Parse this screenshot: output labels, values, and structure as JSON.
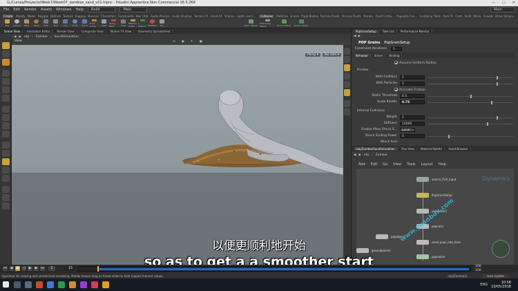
{
  "window": {
    "title": "G:/Cursos/Proyecto/Week7/Week07_zombies_sand_v01.hipnc - Houdini Apprentice Non-Commercial 16.5.268",
    "controls": [
      "—",
      "▢",
      "✕"
    ]
  },
  "menubar": {
    "items": [
      "File",
      "Edit",
      "Render",
      "Assets",
      "Windows",
      "Help"
    ],
    "build_label": "Build",
    "main_label": "Main",
    "desktop_label": "Main"
  },
  "shelf_tabs": [
    "Create",
    "Modify",
    "Model",
    "Polygon",
    "Deform",
    "Texture",
    "Rigging",
    "Muscles",
    "Characters",
    "Constraints",
    "Hair Utils",
    "Guide Process",
    "Guide Brushes",
    "Terrain FX",
    "Cloud FX",
    "Volume",
    "Lights and C...",
    "Collisions",
    "Particles",
    "Grains",
    "Rigid Bodies",
    "Particle Fluids",
    "Viscous Fluids",
    "Oceans",
    "Fluid Contai...",
    "Populate Con...",
    "Container Tools",
    "Pyro FX",
    "Cloth",
    "Solid",
    "Wires",
    "Crowds",
    "Drive Simula..."
  ],
  "shelf_tools": [
    "Box",
    "Sphere",
    "Tube",
    "Torus",
    "Grid",
    "Null",
    "Line",
    "Circle",
    "Curve",
    "Draw Curve",
    "Path",
    "Spray Paint",
    "Font",
    "Platonic Solids",
    "L-System",
    "Metaball",
    "File"
  ],
  "shelf_tools_right": [
    "Static Object",
    "Deforming Object",
    "Ground Plane",
    "Terrain Object"
  ],
  "pane_tabs": [
    "Scene View",
    "Animation Editor",
    "Render View",
    "Composite View",
    "Motion FX View",
    "Geometry Spreadsheet"
  ],
  "path": {
    "root": "obj",
    "node": "Zombie",
    "sub": "SandSimulation"
  },
  "view_label": "View",
  "viewport": {
    "persp": "Persp ▾",
    "camera": "No cam ▾"
  },
  "subtitles": {
    "chinese": "以便更顺利地开始",
    "english": "so as to get a a smoother start"
  },
  "params": {
    "tabs": [
      "PopGrainSetup",
      "Take List",
      "Performance Monitor"
    ],
    "node_type": "POP Grains",
    "node_name": "PopGrainSetup",
    "constraint_iterations_label": "Constraint Iterations",
    "constraint_iterations_value": "5",
    "sub_tabs": [
      "Behavior",
      "Solver",
      "Binding"
    ],
    "assume_uniform_radius": "Assume Uniform Radius",
    "friction_section": "Friction",
    "with_colliders_label": "With Colliders",
    "with_colliders_value": "1",
    "with_particles_label": "With Particles",
    "with_particles_value": "1",
    "accurate_friction": "Accurate Friction",
    "static_threshold_label": "Static Threshold",
    "static_threshold_value": "0.5",
    "scale_kinetic_label": "Scale Kinetic",
    "scale_kinetic_value": "0.75",
    "internal_collisions": "Internal Collisions",
    "weight_label": "Weight",
    "weight_value": "1",
    "stiffness_label": "Stiffness",
    "stiffness_value": "10000",
    "enable_mass_label": "Enable Mass Shock S...",
    "enable_mass_value": "Local",
    "shock_scaling_label": "Shock Scaling Power",
    "shock_scaling_value": "1",
    "shock_axis_label": "Shock Axis"
  },
  "network": {
    "tabs": [
      "/obj/Zombie/SandSimulation",
      "Tree View",
      "Material Palette",
      "Asset Browser"
    ],
    "path_root": "obj",
    "path_node": "Zombie",
    "menu": [
      "Add",
      "Edit",
      "Go",
      "View",
      "Tools",
      "Layout",
      "Help"
    ],
    "dynamics_label": "Dynamics",
    "nodes": [
      {
        "name": "source_first_input",
        "color": "#9aa3a6"
      },
      {
        "name": "PopGrainSetup",
        "color": "#c7b85a"
      },
      {
        "name": "popsolver1",
        "color": "#b9b9b9"
      },
      {
        "name": "popcolor",
        "color": "#b9b9b9"
      },
      {
        "name": "popobject",
        "color": "#b9b9b9"
      },
      {
        "name": "groundplane1",
        "color": "#b9b9b9"
      },
      {
        "name": "sand_pops_into_here",
        "color": "#b9b9b9"
      },
      {
        "name": "popsolver",
        "color": "#b9b9b9"
      }
    ],
    "watermark": "www.yuanbox.com"
  },
  "timeline": {
    "frame_start": "1",
    "current_frame": "15",
    "frame_end_top": "100",
    "frame_end_bottom": "100",
    "ticks": [
      "1",
      "15",
      "24",
      "50",
      "72",
      "84"
    ]
  },
  "statusbar": {
    "hint": "Spacebar for viewing and unrestricted scrubbing. Middle mouse drag on frame slider to hold scoped channel values.",
    "path": "/obj/Zombie/S...",
    "auto_update": "Auto Update"
  },
  "taskbar": {
    "time": "10:58",
    "date": "10/05/2018",
    "lang": "ENG"
  }
}
